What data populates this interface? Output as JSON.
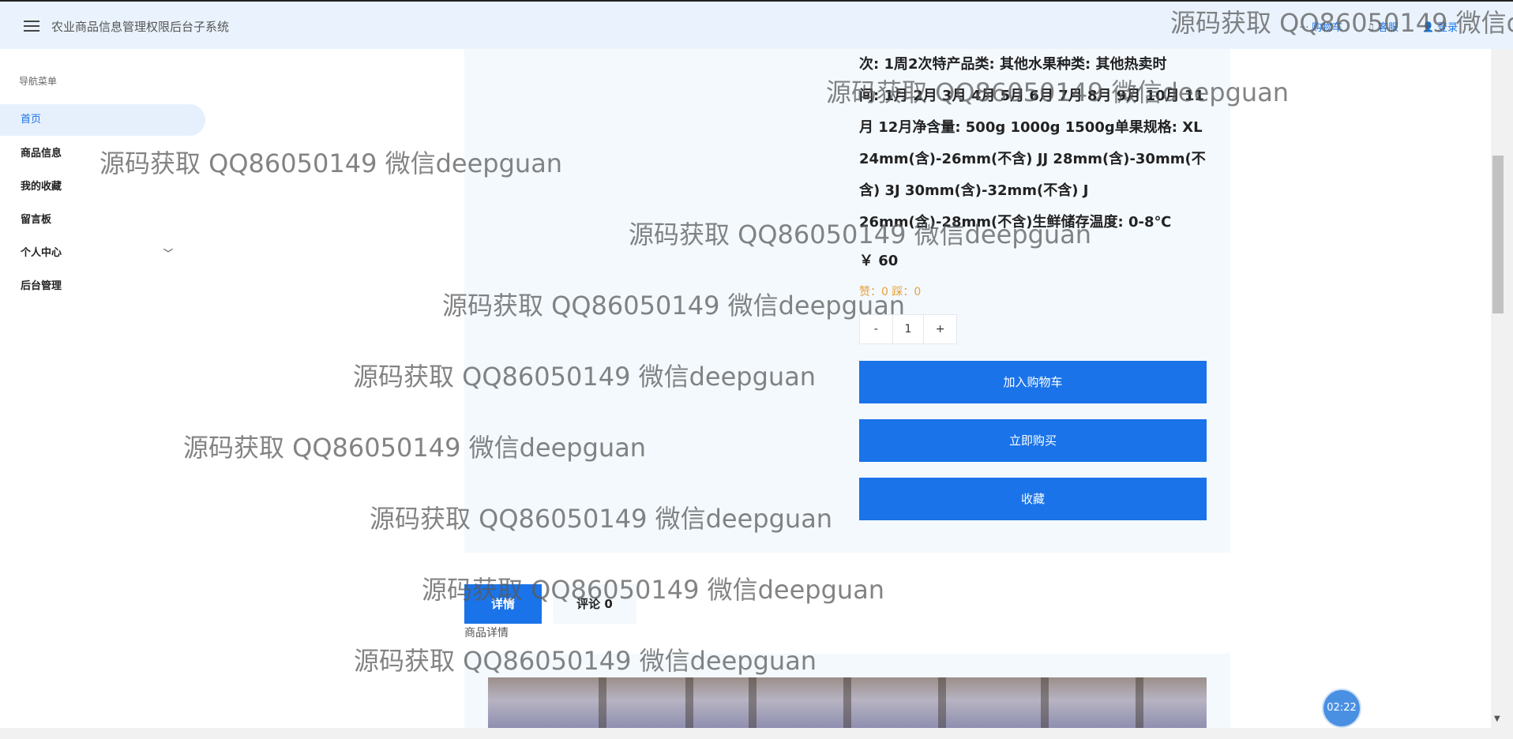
{
  "header": {
    "title": "农业商品信息管理权限后台子系统",
    "links": [
      {
        "icon": "cart-icon",
        "label": "购物车"
      },
      {
        "icon": "headset-icon",
        "label": "客服"
      },
      {
        "icon": "user-icon",
        "label": "登录"
      }
    ]
  },
  "sidebar": {
    "heading": "导航菜单",
    "items": [
      {
        "label": "首页"
      },
      {
        "label": "商品信息"
      },
      {
        "label": "我的收藏"
      },
      {
        "label": "留言板"
      },
      {
        "label": "个人中心"
      },
      {
        "label": "后台管理"
      }
    ]
  },
  "product": {
    "spec_lines": [
      "次: 1周2次特产品类: 其他水果种类: 其他热卖时",
      "间: 1月 2月 3月 4月 5月 6月 7月 8月 9月 10月 11",
      "月 12月净含量: 500g 1000g 1500g单果规格: XL",
      "24mm(含)-26mm(不含) JJ 28mm(含)-30mm(不",
      "含) 3J 30mm(含)-32mm(不含) J",
      "26mm(含)-28mm(不含)生鲜储存温度: 0-8℃"
    ],
    "price": "￥ 60",
    "likes": "赞：0 踩：0",
    "quantity": {
      "minus": "-",
      "value": "1",
      "plus": "+"
    },
    "add_to_cart": "加入购物车",
    "buy_now": "立即购买",
    "favorite": "收藏"
  },
  "tabs": [
    {
      "label": "详情"
    },
    {
      "label": "评论 0"
    }
  ],
  "detail_label": "商品详情",
  "timer": "02:22",
  "watermark": "源码获取 QQ86050149 微信deepguan",
  "colors": {
    "primary": "#1a73e8",
    "header_bg": "#eaf3fd",
    "card_bg": "#f4f9fe",
    "like_color": "#e6a23c"
  }
}
